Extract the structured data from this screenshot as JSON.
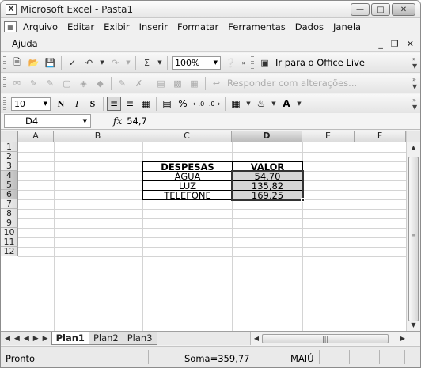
{
  "window": {
    "title": "Microsoft Excel - Pasta1",
    "app_icon": "excel-icon",
    "buttons": [
      "minimize-icon",
      "maximize-icon",
      "close-icon"
    ]
  },
  "menu": {
    "items": [
      "Arquivo",
      "Editar",
      "Exibir",
      "Inserir",
      "Formatar",
      "Ferramentas",
      "Dados",
      "Janela"
    ],
    "second_row": "Ajuda"
  },
  "standard_toolbar": {
    "zoom": "100%",
    "help_text": "Ir para o Office Live"
  },
  "reviewing_toolbar": {
    "reply_text": "Responder com alterações..."
  },
  "formatting_toolbar": {
    "font_size": "10",
    "bold_label": "N",
    "italic_label": "I",
    "underline_label": "S",
    "percent_label": "%"
  },
  "formula_bar": {
    "name_box": "D4",
    "fx_label": "fx",
    "value": "54,7"
  },
  "grid": {
    "columns": [
      "A",
      "B",
      "C",
      "D",
      "E",
      "F"
    ],
    "selected_column": "D",
    "rows": [
      "1",
      "2",
      "3",
      "4",
      "5",
      "6",
      "7",
      "8",
      "9",
      "10",
      "11",
      "12"
    ],
    "selected_rows": [
      "4",
      "5",
      "6"
    ]
  },
  "table": {
    "header_despesas": "DESPESAS",
    "header_valor": "VALOR",
    "rows": [
      {
        "item": "ÁGUA",
        "value": "54,70"
      },
      {
        "item": "LUZ",
        "value": "135,82"
      },
      {
        "item": "TELEFONE",
        "value": "169,25"
      }
    ]
  },
  "sheets": {
    "tabs": [
      "Plan1",
      "Plan2",
      "Plan3"
    ],
    "active": "Plan1"
  },
  "status": {
    "ready": "Pronto",
    "sum": "Soma=359,77",
    "caps": "MAIÚ"
  }
}
